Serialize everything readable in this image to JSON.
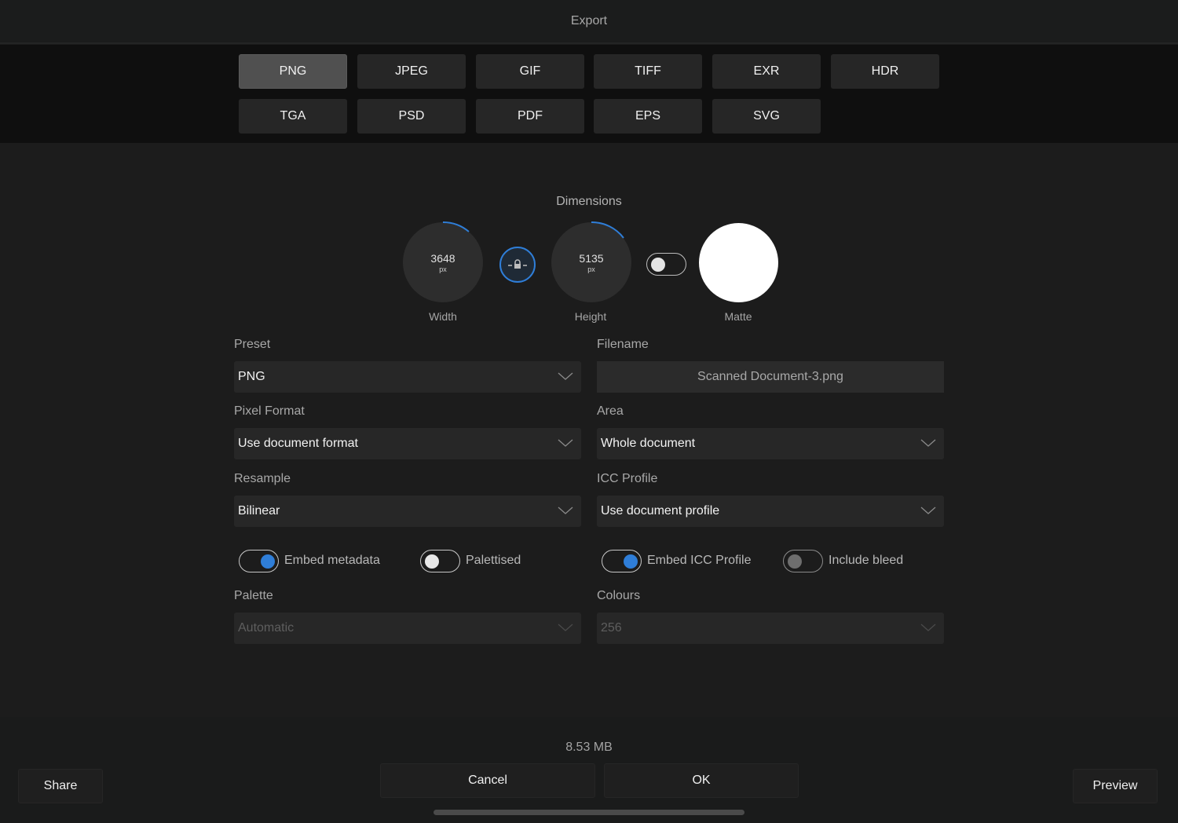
{
  "title": "Export",
  "formats": [
    {
      "label": "PNG",
      "selected": true
    },
    {
      "label": "JPEG",
      "selected": false
    },
    {
      "label": "GIF",
      "selected": false
    },
    {
      "label": "TIFF",
      "selected": false
    },
    {
      "label": "EXR",
      "selected": false
    },
    {
      "label": "HDR",
      "selected": false
    },
    {
      "label": "TGA",
      "selected": false
    },
    {
      "label": "PSD",
      "selected": false
    },
    {
      "label": "PDF",
      "selected": false
    },
    {
      "label": "EPS",
      "selected": false
    },
    {
      "label": "SVG",
      "selected": false
    }
  ],
  "dimensions": {
    "title": "Dimensions",
    "width": {
      "value": "3648",
      "unit": "px",
      "label": "Width"
    },
    "height": {
      "value": "5135",
      "unit": "px",
      "label": "Height"
    },
    "lock_icon": "lock-icon",
    "matte_toggle_on": false,
    "matte": {
      "label": "Matte",
      "color": "#ffffff"
    }
  },
  "fields": {
    "preset": {
      "label": "Preset",
      "value": "PNG"
    },
    "filename": {
      "label": "Filename",
      "value": "Scanned Document-3.png"
    },
    "pixel_format": {
      "label": "Pixel Format",
      "value": "Use document format"
    },
    "area": {
      "label": "Area",
      "value": "Whole document"
    },
    "resample": {
      "label": "Resample",
      "value": "Bilinear"
    },
    "icc_profile": {
      "label": "ICC Profile",
      "value": "Use document profile"
    },
    "palette": {
      "label": "Palette",
      "value": "Automatic",
      "disabled": true
    },
    "colours": {
      "label": "Colours",
      "value": "256",
      "disabled": true
    }
  },
  "toggles": {
    "embed_metadata": {
      "label": "Embed metadata",
      "on": true
    },
    "palettised": {
      "label": "Palettised",
      "on": false
    },
    "embed_icc": {
      "label": "Embed ICC Profile",
      "on": true
    },
    "include_bleed": {
      "label": "Include bleed",
      "on": false,
      "disabled": true
    }
  },
  "footer": {
    "file_size": "8.53 MB",
    "share": "Share",
    "cancel": "Cancel",
    "ok": "OK",
    "preview": "Preview"
  },
  "colors": {
    "accent": "#2f7ed8"
  }
}
